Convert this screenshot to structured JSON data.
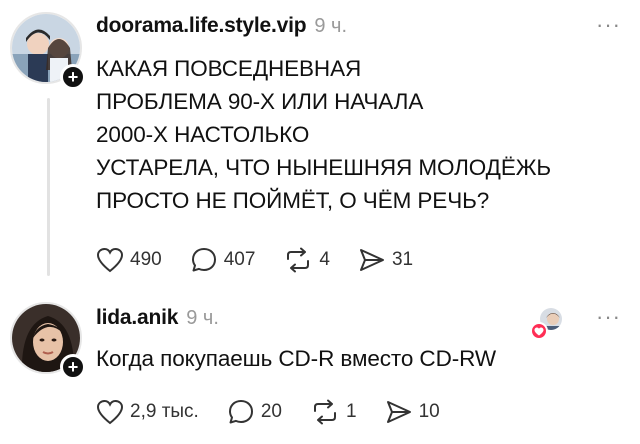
{
  "post1": {
    "username": "doorama.life.style.vip",
    "time": "9 ч.",
    "more": "···",
    "text": "КАКАЯ ПОВСЕДНЕВНАЯ\nПРОБЛЕМА 90-Х ИЛИ НАЧАЛА\n2000-Х НАСТОЛЬКО\nУСТАРЕЛА, ЧТО НЫНЕШНЯЯ МОЛОДЁЖЬ\nПРОСТО НЕ ПОЙМЁТ, О ЧЁМ РЕЧЬ?",
    "likes": "490",
    "comments": "407",
    "reposts": "4",
    "shares": "31",
    "follow_symbol": "+"
  },
  "post2": {
    "username": "lida.anik",
    "time": "9 ч.",
    "more": "···",
    "text": "Когда  покупаешь CD-R вместо CD-RW",
    "likes": "2,9 тыс.",
    "comments": "20",
    "reposts": "1",
    "shares": "10",
    "follow_symbol": "+"
  },
  "icons": {
    "like": "heart-outline-icon",
    "comment": "comment-bubble-icon",
    "repost": "repost-arrows-icon",
    "share": "send-arrow-icon",
    "follow": "plus-icon",
    "more": "more-dots-icon"
  },
  "colors": {
    "background": "#ffffff",
    "text": "#111111",
    "muted": "#9a9a9a",
    "heart_badge": "#ff2e55"
  }
}
